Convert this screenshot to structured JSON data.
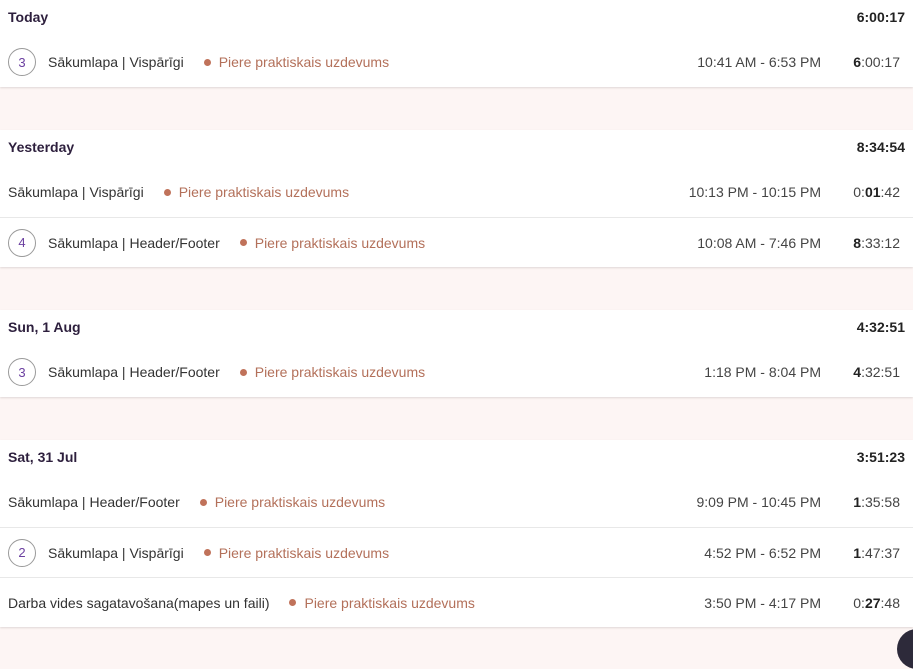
{
  "colors": {
    "page_bg": "#fdf5f4",
    "project_dot": "#c0725a",
    "project_text": "#b3705a",
    "badge_text": "#6b3fa0",
    "header_text": "#2d1f3d"
  },
  "groups": [
    {
      "label": "Today",
      "total": "6:00:17",
      "entries": [
        {
          "count": "3",
          "task": "Sākumlapa | Vispārīgi",
          "project": "Piere praktiskais uzdevums",
          "range": "10:41 AM - 6:53 PM",
          "dur_pre": "",
          "dur_bold": "6",
          "dur_post": ":00:17"
        }
      ]
    },
    {
      "label": "Yesterday",
      "total": "8:34:54",
      "entries": [
        {
          "count": null,
          "task": "Sākumlapa | Vispārīgi",
          "project": "Piere praktiskais uzdevums",
          "range": "10:13 PM - 10:15 PM",
          "dur_pre": "0:",
          "dur_bold": "01",
          "dur_post": ":42"
        },
        {
          "count": "4",
          "task": "Sākumlapa | Header/Footer",
          "project": "Piere praktiskais uzdevums",
          "range": "10:08 AM - 7:46 PM",
          "dur_pre": "",
          "dur_bold": "8",
          "dur_post": ":33:12"
        }
      ]
    },
    {
      "label": "Sun, 1 Aug",
      "total": "4:32:51",
      "entries": [
        {
          "count": "3",
          "task": "Sākumlapa | Header/Footer",
          "project": "Piere praktiskais uzdevums",
          "range": "1:18 PM - 8:04 PM",
          "dur_pre": "",
          "dur_bold": "4",
          "dur_post": ":32:51"
        }
      ]
    },
    {
      "label": "Sat, 31 Jul",
      "total": "3:51:23",
      "entries": [
        {
          "count": null,
          "task": "Sākumlapa | Header/Footer",
          "project": "Piere praktiskais uzdevums",
          "range": "9:09 PM - 10:45 PM",
          "dur_pre": "",
          "dur_bold": "1",
          "dur_post": ":35:58"
        },
        {
          "count": "2",
          "task": "Sākumlapa | Vispārīgi",
          "project": "Piere praktiskais uzdevums",
          "range": "4:52 PM - 6:52 PM",
          "dur_pre": "",
          "dur_bold": "1",
          "dur_post": ":47:37"
        },
        {
          "count": null,
          "task": "Darba vides sagatavošana(mapes un faili)",
          "project": "Piere praktiskais uzdevums",
          "range": "3:50 PM - 4:17 PM",
          "dur_pre": "0:",
          "dur_bold": "27",
          "dur_post": ":48"
        }
      ]
    }
  ]
}
